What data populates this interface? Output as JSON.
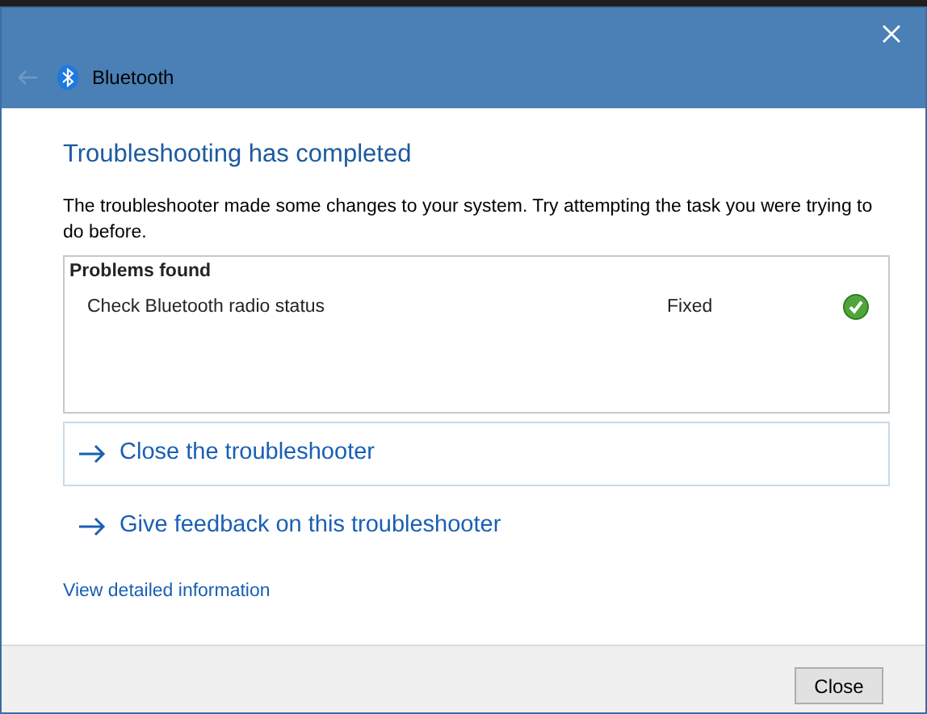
{
  "window": {
    "title": "Bluetooth",
    "back_enabled": false
  },
  "heading": "Troubleshooting has completed",
  "description": "The troubleshooter made some changes to your system. Try attempting the task you were trying to do before.",
  "problems": {
    "title": "Problems found",
    "rows": [
      {
        "problem": "Check Bluetooth radio status",
        "status": "Fixed",
        "fixed": true
      }
    ]
  },
  "actions": [
    {
      "label": "Close the troubleshooter",
      "focused": true
    },
    {
      "label": "Give feedback on this troubleshooter",
      "focused": false
    }
  ],
  "details_link": "View detailed information",
  "buttons": [
    "Close"
  ]
}
